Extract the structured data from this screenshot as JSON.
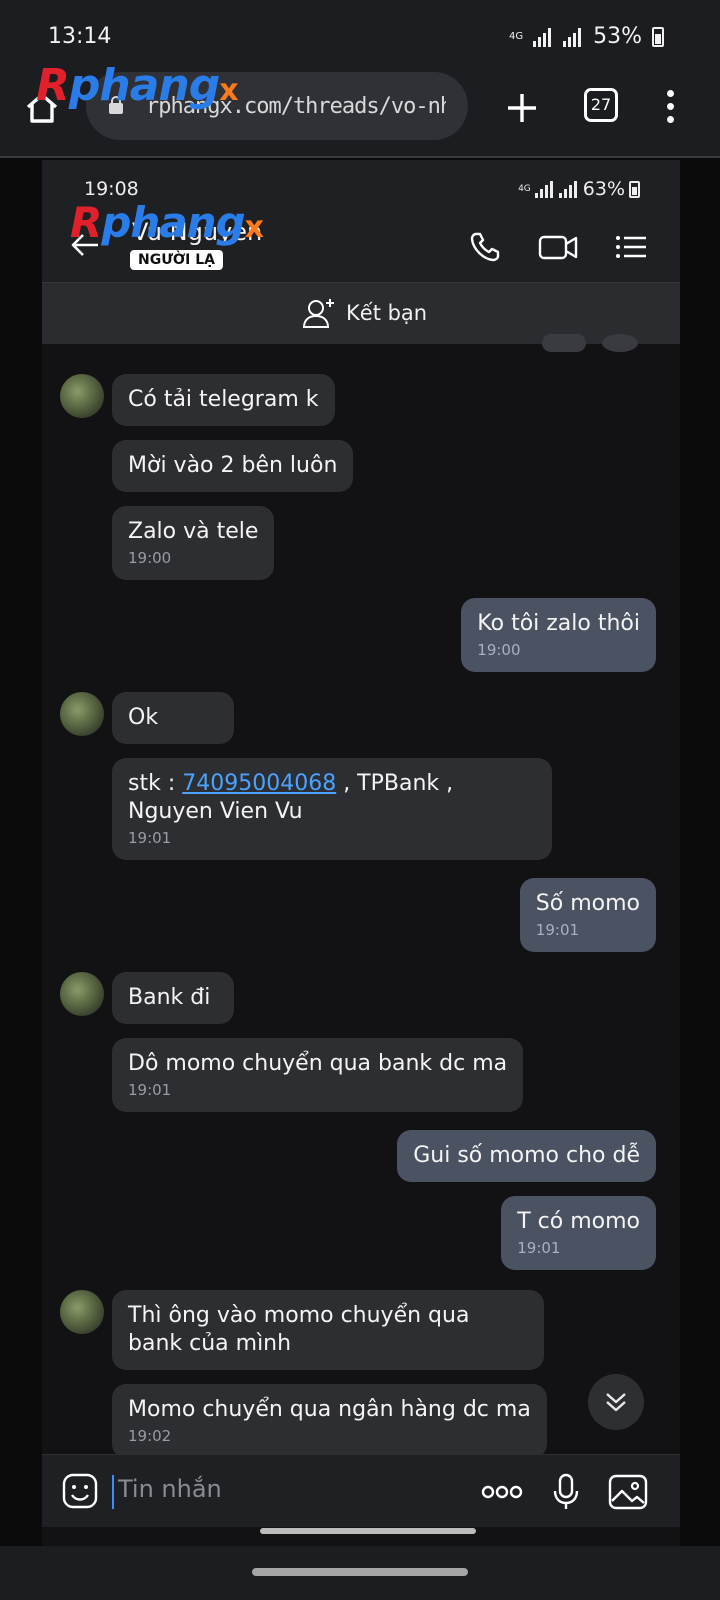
{
  "outer_status": {
    "time": "13:14",
    "network": "4G",
    "battery": "53%"
  },
  "browser": {
    "url": "rphangx.com/threads/vo-nhon",
    "tab_count": "27"
  },
  "logo": {
    "r": "R",
    "main": "phang",
    "x": "x"
  },
  "inner_status": {
    "time": "19:08",
    "network": "4G",
    "battery": "63%"
  },
  "chat_header": {
    "contact_name": "Vu Nguyen",
    "stranger_label": "NGƯỜI LẠ"
  },
  "add_friend": {
    "label": "Kết bạn"
  },
  "messages": [
    {
      "text": "Có tải telegram k"
    },
    {
      "text": "Mời vào 2 bên luôn"
    },
    {
      "text": "Zalo và tele",
      "time": "19:00"
    },
    {
      "text": "Ko tôi zalo thôi",
      "time": "19:00"
    },
    {
      "text": "Ok"
    },
    {
      "prefix": "stk : ",
      "link": "74095004068",
      "suffix": " , TPBank , Nguyen Vien Vu",
      "time": "19:01"
    },
    {
      "text": "Số momo",
      "time": "19:01"
    },
    {
      "text": "Bank đi"
    },
    {
      "text": "Dô momo chuyển qua bank dc ma",
      "time": "19:01"
    },
    {
      "text": "Gui số momo cho dễ"
    },
    {
      "text": "T có momo",
      "time": "19:01"
    },
    {
      "text": "Thì ông vào momo chuyển qua bank của mình"
    },
    {
      "text": "Momo chuyển qua ngân hàng dc ma",
      "time": "19:02"
    }
  ],
  "input": {
    "placeholder": "Tin nhắn"
  },
  "icons": {
    "home": "home-icon",
    "lock": "lock-icon",
    "plus": "plus-icon",
    "more": "more-vertical-icon",
    "back": "back-arrow-icon",
    "call": "phone-icon",
    "video": "video-camera-icon",
    "menu": "list-menu-icon",
    "add_friend": "add-friend-icon",
    "emoji": "sticker-icon",
    "options": "more-horizontal-icon",
    "mic": "microphone-icon",
    "image": "image-icon",
    "scroll": "double-chevron-down-icon"
  },
  "colors": {
    "incoming_bubble": "#2d2e32",
    "outgoing_bubble": "#4b5262",
    "link": "#4aa3ff",
    "background": "#121214"
  }
}
